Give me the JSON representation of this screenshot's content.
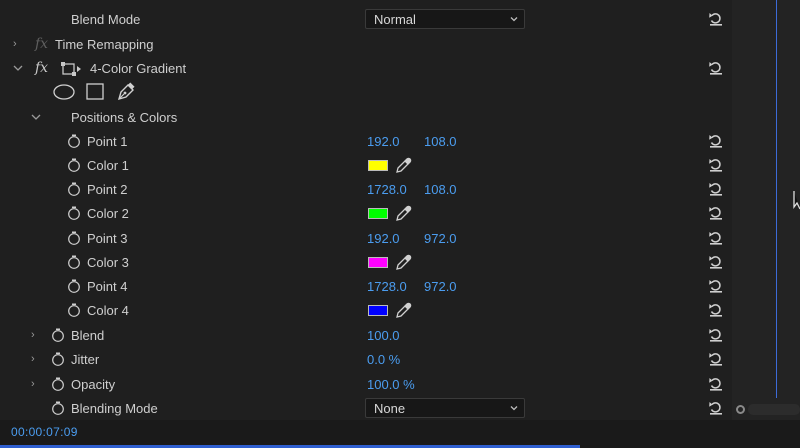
{
  "rows": {
    "blend_mode": {
      "label": "Blend Mode",
      "value": "Normal"
    },
    "time_remapping": {
      "label": "Time Remapping"
    },
    "gradient": {
      "label": "4-Color Gradient"
    },
    "positions": {
      "label": "Positions & Colors"
    },
    "point1": {
      "label": "Point 1",
      "x": "192.0",
      "y": "108.0"
    },
    "color1": {
      "label": "Color 1",
      "color": "#ffff00"
    },
    "point2": {
      "label": "Point 2",
      "x": "1728.0",
      "y": "108.0"
    },
    "color2": {
      "label": "Color 2",
      "color": "#00ff00"
    },
    "point3": {
      "label": "Point 3",
      "x": "192.0",
      "y": "972.0"
    },
    "color3": {
      "label": "Color 3",
      "color": "#ff00ff"
    },
    "point4": {
      "label": "Point 4",
      "x": "1728.0",
      "y": "972.0"
    },
    "color4": {
      "label": "Color 4",
      "color": "#0000ff"
    },
    "blend": {
      "label": "Blend",
      "value": "100.0"
    },
    "jitter": {
      "label": "Jitter",
      "value": "0.0 %"
    },
    "opacity": {
      "label": "Opacity",
      "value": "100.0 %"
    },
    "blending_mode": {
      "label": "Blending Mode",
      "value": "None"
    }
  },
  "footer": {
    "timecode": "00:00:07:09"
  },
  "icons": {
    "reset": "reset-icon",
    "stopwatch": "stopwatch-icon",
    "eyedropper": "eyedropper-icon",
    "ellipse_mask": "ellipse-mask-icon",
    "rect_mask": "rectangle-mask-icon",
    "pen_mask": "pen-mask-icon",
    "effect_toggle": "fx-icon"
  },
  "colors": {
    "value_blue": "#4b9df0",
    "playhead": "#3d6bd8"
  }
}
